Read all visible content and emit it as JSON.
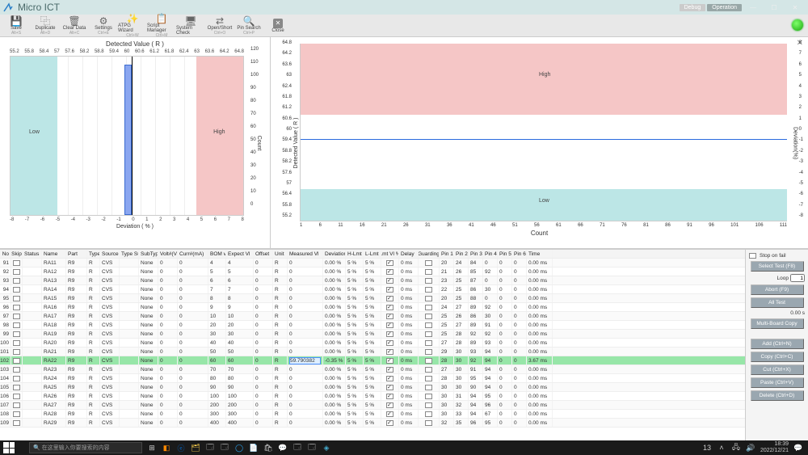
{
  "app": {
    "title": "Micro ICT"
  },
  "titlebar": {
    "debug": "Debug",
    "operation": "Operation"
  },
  "toolbar": [
    {
      "label": "Save",
      "sub": "Alt+S",
      "icon": "💾"
    },
    {
      "label": "Duplicate",
      "sub": "Alt+D",
      "icon": "⿻"
    },
    {
      "label": "Clear Data",
      "sub": "Alt+C",
      "icon": "🗑"
    },
    {
      "label": "Settings",
      "sub": "Ctrl+E",
      "icon": "⚙"
    },
    {
      "label": "ATPG Wizard",
      "sub": "Ctrl+W",
      "icon": "✨"
    },
    {
      "label": "Script Manager",
      "sub": "Ctrl+M",
      "icon": "📋"
    },
    {
      "label": "System Check",
      "sub": "",
      "icon": "🖥"
    },
    {
      "label": "Open/Short",
      "sub": "Ctrl+O",
      "icon": "⇄"
    },
    {
      "label": "Pin Search",
      "sub": "Ctrl+P",
      "icon": "🔍"
    },
    {
      "label": "Close",
      "sub": "",
      "icon": "✕"
    }
  ],
  "chart_data": [
    {
      "type": "bar",
      "title": "Detected Value ( R )",
      "xlabel": "Deviation  ( % )",
      "ylabel": "Count",
      "low_label": "Low",
      "high_label": "High",
      "x_top_ticks": [
        "55.2",
        "55.8",
        "58.4",
        "57",
        "57.6",
        "58.2",
        "58.8",
        "59.4",
        "60",
        "60.6",
        "61.2",
        "61.8",
        "62.4",
        "63",
        "63.6",
        "64.2",
        "64.8"
      ],
      "x_bottom_ticks": [
        "-8",
        "-7",
        "-6",
        "-5",
        "-4",
        "-3",
        "-2",
        "-1",
        "0",
        "1",
        "2",
        "3",
        "4",
        "5",
        "6",
        "7",
        "8"
      ],
      "y_ticks": [
        "120",
        "110",
        "100",
        "90",
        "80",
        "70",
        "60",
        "50",
        "40",
        "30",
        "20",
        "10",
        "0"
      ],
      "categories": [
        "-8",
        "-7",
        "-6",
        "-5",
        "-4",
        "-3",
        "-2",
        "-1",
        "0",
        "1",
        "2",
        "3",
        "4",
        "5",
        "6",
        "7",
        "8"
      ],
      "values": [
        0,
        0,
        0,
        0,
        0,
        0,
        0,
        0,
        112,
        0,
        0,
        0,
        0,
        0,
        0,
        0,
        0
      ],
      "low_band": [
        -8,
        -5
      ],
      "high_band": [
        5,
        8
      ]
    },
    {
      "type": "line",
      "title": "",
      "xlabel": "Count",
      "ylabel_left": "Detected Value ( R )",
      "ylabel_right": "Deviation(%)",
      "low_label": "Low",
      "high_label": "High",
      "x_ticks": [
        "1",
        "6",
        "11",
        "16",
        "21",
        "26",
        "31",
        "36",
        "41",
        "46",
        "51",
        "56",
        "61",
        "66",
        "71",
        "76",
        "81",
        "86",
        "91",
        "96",
        "101",
        "106",
        "111"
      ],
      "y_left_ticks": [
        "64.8",
        "64.2",
        "63.6",
        "63",
        "62.4",
        "61.8",
        "61.2",
        "60.6",
        "60",
        "59.4",
        "58.8",
        "58.2",
        "57.6",
        "57",
        "56.4",
        "55.8",
        "55.2"
      ],
      "y_right_ticks": [
        "8",
        "7",
        "6",
        "5",
        "4",
        "3",
        "2",
        "1",
        "0",
        "-1",
        "-2",
        "-3",
        "-4",
        "-5",
        "-6",
        "-7",
        "-8"
      ],
      "series": [
        {
          "name": "Detected",
          "approx_constant": 59.8
        }
      ],
      "high_band": [
        63,
        64.8
      ],
      "low_band": [
        55.2,
        57
      ]
    }
  ],
  "grid": {
    "headers": [
      "No",
      "Skip",
      "Status",
      "Name",
      "Part",
      "Type",
      "Source",
      "Type Sub",
      "SubType",
      "Volt#(V)",
      "Curr#(mA)",
      "BOM vl",
      "Expect Vl",
      "Offset",
      "Unit",
      "Measured Vl",
      "Deviation",
      "H-Lmt",
      "L-Lmt",
      "Lmt Vl %",
      "Delay",
      "Guarding",
      "Pin 1",
      "Pin 2",
      "Pin 3",
      "Pin 4",
      "Pin 5",
      "Pin 6",
      "Time"
    ],
    "rows": [
      {
        "no": 91,
        "name": "RA11",
        "part": "R9",
        "type": "R",
        "src": "CVS",
        "sub": "None",
        "v": 0,
        "c": 0,
        "bom": 4,
        "ev": 4,
        "off": 0,
        "unit": "R",
        "mv": 0,
        "dev": "0.00 %",
        "hl": "5 %",
        "ll": "5 %",
        "lv": true,
        "de": "0 ms",
        "ga": false,
        "p": [
          20,
          24,
          84,
          0,
          0,
          0
        ],
        "tm": "0.00 ms"
      },
      {
        "no": 92,
        "name": "RA12",
        "part": "R9",
        "type": "R",
        "src": "CVS",
        "sub": "None",
        "v": 0,
        "c": 0,
        "bom": 5,
        "ev": 5,
        "off": 0,
        "unit": "R",
        "mv": 0,
        "dev": "0.00 %",
        "hl": "5 %",
        "ll": "5 %",
        "lv": true,
        "de": "0 ms",
        "ga": false,
        "p": [
          21,
          26,
          85,
          92,
          0,
          0
        ],
        "tm": "0.00 ms"
      },
      {
        "no": 93,
        "name": "RA13",
        "part": "R9",
        "type": "R",
        "src": "CVS",
        "sub": "None",
        "v": 0,
        "c": 0,
        "bom": 6,
        "ev": 6,
        "off": 0,
        "unit": "R",
        "mv": 0,
        "dev": "0.00 %",
        "hl": "5 %",
        "ll": "5 %",
        "lv": true,
        "de": "0 ms",
        "ga": false,
        "p": [
          23,
          25,
          87,
          0,
          0,
          0
        ],
        "tm": "0.00 ms"
      },
      {
        "no": 94,
        "name": "RA14",
        "part": "R9",
        "type": "R",
        "src": "CVS",
        "sub": "None",
        "v": 0,
        "c": 0,
        "bom": 7,
        "ev": 7,
        "off": 0,
        "unit": "R",
        "mv": 0,
        "dev": "0.00 %",
        "hl": "5 %",
        "ll": "5 %",
        "lv": true,
        "de": "0 ms",
        "ga": false,
        "p": [
          22,
          25,
          86,
          30,
          0,
          0
        ],
        "tm": "0.00 ms"
      },
      {
        "no": 95,
        "name": "RA15",
        "part": "R9",
        "type": "R",
        "src": "CVS",
        "sub": "None",
        "v": 0,
        "c": 0,
        "bom": 8,
        "ev": 8,
        "off": 0,
        "unit": "R",
        "mv": 0,
        "dev": "0.00 %",
        "hl": "5 %",
        "ll": "5 %",
        "lv": true,
        "de": "0 ms",
        "ga": false,
        "p": [
          20,
          25,
          88,
          0,
          0,
          0
        ],
        "tm": "0.00 ms"
      },
      {
        "no": 96,
        "name": "RA16",
        "part": "R9",
        "type": "R",
        "src": "CVS",
        "sub": "None",
        "v": 0,
        "c": 0,
        "bom": 9,
        "ev": 9,
        "off": 0,
        "unit": "R",
        "mv": 0,
        "dev": "0.00 %",
        "hl": "5 %",
        "ll": "5 %",
        "lv": true,
        "de": "0 ms",
        "ga": false,
        "p": [
          24,
          27,
          89,
          92,
          0,
          0
        ],
        "tm": "0.00 ms"
      },
      {
        "no": 97,
        "name": "RA17",
        "part": "R9",
        "type": "R",
        "src": "CVS",
        "sub": "None",
        "v": 0,
        "c": 0,
        "bom": 10,
        "ev": 10,
        "off": 0,
        "unit": "R",
        "mv": 0,
        "dev": "0.00 %",
        "hl": "5 %",
        "ll": "5 %",
        "lv": true,
        "de": "0 ms",
        "ga": false,
        "p": [
          25,
          26,
          86,
          30,
          0,
          0
        ],
        "tm": "0.00 ms"
      },
      {
        "no": 98,
        "name": "RA18",
        "part": "R9",
        "type": "R",
        "src": "CVS",
        "sub": "None",
        "v": 0,
        "c": 0,
        "bom": 20,
        "ev": 20,
        "off": 0,
        "unit": "R",
        "mv": 0,
        "dev": "0.00 %",
        "hl": "5 %",
        "ll": "5 %",
        "lv": true,
        "de": "0 ms",
        "ga": false,
        "p": [
          25,
          27,
          89,
          91,
          0,
          0
        ],
        "tm": "0.00 ms"
      },
      {
        "no": 99,
        "name": "RA19",
        "part": "R9",
        "type": "R",
        "src": "CVS",
        "sub": "None",
        "v": 0,
        "c": 0,
        "bom": 30,
        "ev": 30,
        "off": 0,
        "unit": "R",
        "mv": 0,
        "dev": "0.00 %",
        "hl": "5 %",
        "ll": "5 %",
        "lv": true,
        "de": "0 ms",
        "ga": false,
        "p": [
          25,
          28,
          92,
          92,
          0,
          0
        ],
        "tm": "0.00 ms"
      },
      {
        "no": 100,
        "name": "RA20",
        "part": "R9",
        "type": "R",
        "src": "CVS",
        "sub": "None",
        "v": 0,
        "c": 0,
        "bom": 40,
        "ev": 40,
        "off": 0,
        "unit": "R",
        "mv": 0,
        "dev": "0.00 %",
        "hl": "5 %",
        "ll": "5 %",
        "lv": true,
        "de": "0 ms",
        "ga": false,
        "p": [
          27,
          28,
          89,
          93,
          0,
          0
        ],
        "tm": "0.00 ms"
      },
      {
        "no": 101,
        "name": "RA21",
        "part": "R9",
        "type": "R",
        "src": "CVS",
        "sub": "None",
        "v": 0,
        "c": 0,
        "bom": 50,
        "ev": 50,
        "off": 0,
        "unit": "R",
        "mv": 0,
        "dev": "0.00 %",
        "hl": "5 %",
        "ll": "5 %",
        "lv": true,
        "de": "0 ms",
        "ga": false,
        "p": [
          29,
          30,
          93,
          94,
          0,
          0
        ],
        "tm": "0.00 ms"
      },
      {
        "no": 102,
        "hl_row": true,
        "name": "RA22",
        "part": "R9",
        "type": "R",
        "src": "CVS",
        "sub": "None",
        "v": 0,
        "c": 0,
        "bom": 60,
        "ev": 60,
        "off": 0,
        "unit": "R",
        "mv": "59.790382",
        "dev": "-0.35 %",
        "hl": "5 %",
        "ll": "5 %",
        "lv": true,
        "de": "0 ms",
        "ga": false,
        "p": [
          28,
          30,
          92,
          94,
          0,
          0
        ],
        "tm": "3.67 ms"
      },
      {
        "no": 103,
        "name": "RA23",
        "part": "R9",
        "type": "R",
        "src": "CVS",
        "sub": "None",
        "v": 0,
        "c": 0,
        "bom": 70,
        "ev": 70,
        "off": 0,
        "unit": "R",
        "mv": 0,
        "dev": "0.00 %",
        "hl": "5 %",
        "ll": "5 %",
        "lv": true,
        "de": "0 ms",
        "ga": false,
        "p": [
          27,
          30,
          91,
          94,
          0,
          0
        ],
        "tm": "0.00 ms"
      },
      {
        "no": 104,
        "name": "RA24",
        "part": "R9",
        "type": "R",
        "src": "CVS",
        "sub": "None",
        "v": 0,
        "c": 0,
        "bom": 80,
        "ev": 80,
        "off": 0,
        "unit": "R",
        "mv": 0,
        "dev": "0.00 %",
        "hl": "5 %",
        "ll": "5 %",
        "lv": true,
        "de": "0 ms",
        "ga": false,
        "p": [
          28,
          30,
          95,
          94,
          0,
          0
        ],
        "tm": "0.00 ms"
      },
      {
        "no": 105,
        "name": "RA25",
        "part": "R9",
        "type": "R",
        "src": "CVS",
        "sub": "None",
        "v": 0,
        "c": 0,
        "bom": 90,
        "ev": 90,
        "off": 0,
        "unit": "R",
        "mv": 0,
        "dev": "0.00 %",
        "hl": "5 %",
        "ll": "5 %",
        "lv": true,
        "de": "0 ms",
        "ga": false,
        "p": [
          30,
          30,
          90,
          94,
          0,
          0
        ],
        "tm": "0.00 ms"
      },
      {
        "no": 106,
        "name": "RA26",
        "part": "R9",
        "type": "R",
        "src": "CVS",
        "sub": "None",
        "v": 0,
        "c": 0,
        "bom": 100,
        "ev": 100,
        "off": 0,
        "unit": "R",
        "mv": 0,
        "dev": "0.00 %",
        "hl": "5 %",
        "ll": "5 %",
        "lv": true,
        "de": "0 ms",
        "ga": false,
        "p": [
          30,
          31,
          94,
          95,
          0,
          0
        ],
        "tm": "0.00 ms"
      },
      {
        "no": 107,
        "name": "RA27",
        "part": "R9",
        "type": "R",
        "src": "CVS",
        "sub": "None",
        "v": 0,
        "c": 0,
        "bom": 200,
        "ev": 200,
        "off": 0,
        "unit": "R",
        "mv": 0,
        "dev": "0.00 %",
        "hl": "5 %",
        "ll": "5 %",
        "lv": true,
        "de": "0 ms",
        "ga": false,
        "p": [
          30,
          32,
          94,
          96,
          0,
          0
        ],
        "tm": "0.00 ms"
      },
      {
        "no": 108,
        "name": "RA28",
        "part": "R9",
        "type": "R",
        "src": "CVS",
        "sub": "None",
        "v": 0,
        "c": 0,
        "bom": 300,
        "ev": 300,
        "off": 0,
        "unit": "R",
        "mv": 0,
        "dev": "0.00 %",
        "hl": "5 %",
        "ll": "5 %",
        "lv": true,
        "de": "0 ms",
        "ga": false,
        "p": [
          30,
          33,
          94,
          67,
          0,
          0
        ],
        "tm": "0.00 ms"
      },
      {
        "no": 109,
        "name": "RA29",
        "part": "R9",
        "type": "R",
        "src": "CVS",
        "sub": "None",
        "v": 0,
        "c": 0,
        "bom": 400,
        "ev": 400,
        "off": 0,
        "unit": "R",
        "mv": 0,
        "dev": "0.00 %",
        "hl": "5 %",
        "ll": "5 %",
        "lv": true,
        "de": "0 ms",
        "ga": false,
        "p": [
          32,
          35,
          96,
          95,
          0,
          0
        ],
        "tm": "0.00 ms"
      }
    ]
  },
  "rpanel": {
    "stop_on_fail": "Stop on fail",
    "select_test": "Select Test (F8)",
    "loop_lbl": "Loop",
    "loop_val": "1",
    "abort": "Abort (F9)",
    "all_test": "All Test",
    "sec": "0.00 s",
    "multi": "Multi-Board Copy",
    "add": "Add (Ctrl+N)",
    "copy": "Copy (Ctrl+C)",
    "cut": "Cut (Ctrl+X)",
    "paste": "Paste (Ctrl+V)",
    "delete": "Delete (Ctrl+D)"
  },
  "taskbar": {
    "search": "在这里输入你要搜索的内容",
    "time": "18:39",
    "date": "2022/12/21",
    "badge": "13"
  }
}
